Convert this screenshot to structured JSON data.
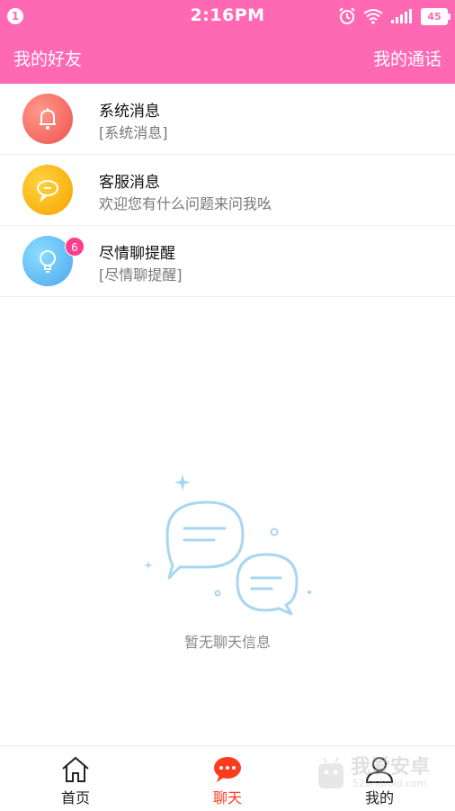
{
  "status": {
    "notification_count": "1",
    "time": "2:16PM",
    "battery": "45"
  },
  "header": {
    "left_label": "我的好友",
    "right_label": "我的通话"
  },
  "messages": [
    {
      "title": "系统消息",
      "subtitle": "[系统消息]",
      "icon": "bell-icon",
      "color": "#f0504f"
    },
    {
      "title": "客服消息",
      "subtitle": "欢迎您有什么问题来问我吆",
      "icon": "chat-bubble-icon",
      "color": "#f6a400"
    },
    {
      "title": "尽情聊提醒",
      "subtitle": "[尽情聊提醒]",
      "icon": "lightbulb-icon",
      "color": "#4aa8ee",
      "badge": "6"
    }
  ],
  "empty_state": {
    "text": "暂无聊天信息",
    "icon": "chat-bubbles-illustration"
  },
  "tabbar": {
    "tabs": [
      {
        "label": "首页",
        "icon": "home-icon"
      },
      {
        "label": "聊天",
        "icon": "chat-icon",
        "active": true
      },
      {
        "label": "我的",
        "icon": "user-icon"
      }
    ]
  },
  "watermark": {
    "text": "我爱安卓",
    "sub": "52android.com"
  },
  "colors": {
    "accent": "#ff69b4",
    "active_tab": "#ff3b1f"
  }
}
